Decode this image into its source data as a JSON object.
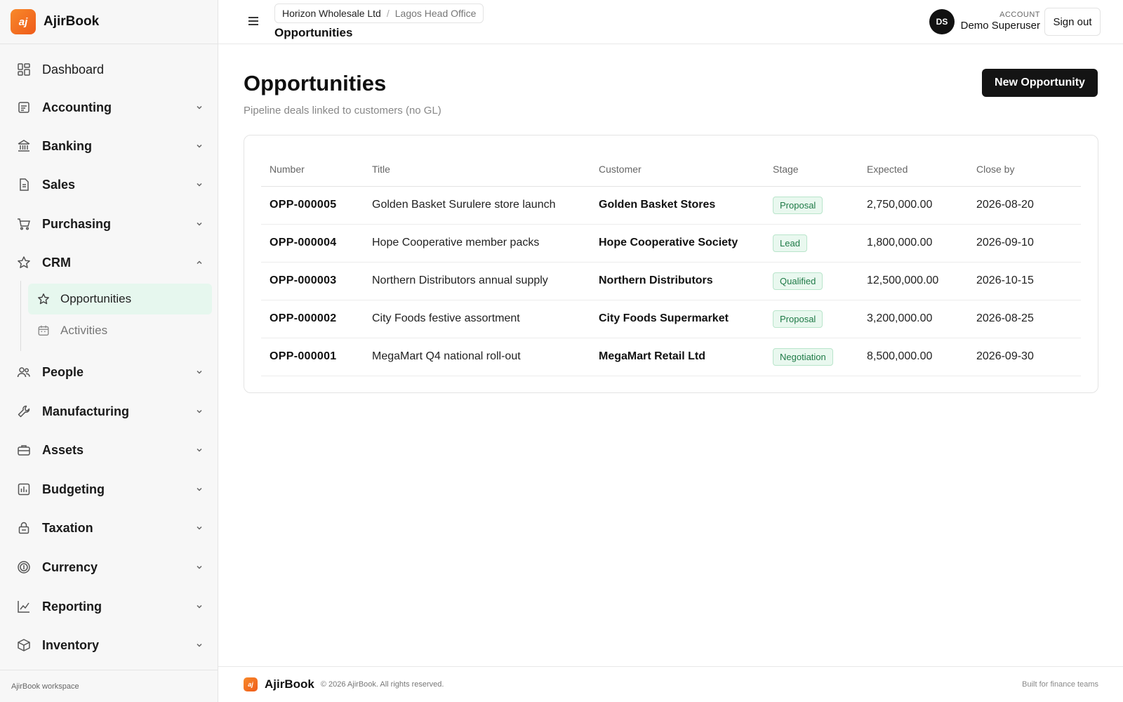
{
  "brand": {
    "name": "AjirBook",
    "logo_text": "aj",
    "accent": "#f26b21"
  },
  "sidebar": {
    "items": [
      {
        "label": "Dashboard",
        "icon": "dashboard-icon"
      },
      {
        "label": "Accounting",
        "icon": "accounting-icon"
      },
      {
        "label": "Banking",
        "icon": "bank-icon"
      },
      {
        "label": "Sales",
        "icon": "sales-icon"
      },
      {
        "label": "Purchasing",
        "icon": "cart-icon"
      },
      {
        "label": "CRM",
        "icon": "star-icon",
        "expanded": true
      },
      {
        "label": "People",
        "icon": "people-icon"
      },
      {
        "label": "Manufacturing",
        "icon": "wrench-icon"
      },
      {
        "label": "Assets",
        "icon": "briefcase-icon"
      },
      {
        "label": "Budgeting",
        "icon": "budget-icon"
      },
      {
        "label": "Taxation",
        "icon": "lock-icon"
      },
      {
        "label": "Currency",
        "icon": "currency-icon"
      },
      {
        "label": "Reporting",
        "icon": "chart-icon"
      },
      {
        "label": "Inventory",
        "icon": "box-icon"
      }
    ],
    "crm_sub": [
      {
        "label": "Opportunities",
        "icon": "star-icon",
        "active": true
      },
      {
        "label": "Activities",
        "icon": "calendar-icon",
        "active": false
      }
    ],
    "footer": "AjirBook workspace"
  },
  "topbar": {
    "org": "Horizon Wholesale Ltd",
    "separator": "/",
    "branch": "Lagos Head Office",
    "title": "Opportunities",
    "avatar_initials": "DS",
    "account_label": "ACCOUNT",
    "account_name": "Demo Superuser",
    "signout": "Sign out"
  },
  "page": {
    "title": "Opportunities",
    "subtitle": "Pipeline deals linked to customers (no GL)",
    "new_button": "New Opportunity"
  },
  "table": {
    "columns": [
      "Number",
      "Title",
      "Customer",
      "Stage",
      "Expected",
      "Close by"
    ],
    "rows": [
      {
        "number": "OPP-000005",
        "title": "Golden Basket Surulere store launch",
        "customer": "Golden Basket Stores",
        "stage": "Proposal",
        "expected": "2,750,000.00",
        "close_by": "2026-08-20"
      },
      {
        "number": "OPP-000004",
        "title": "Hope Cooperative member packs",
        "customer": "Hope Cooperative Society",
        "stage": "Lead",
        "expected": "1,800,000.00",
        "close_by": "2026-09-10"
      },
      {
        "number": "OPP-000003",
        "title": "Northern Distributors annual supply",
        "customer": "Northern Distributors",
        "stage": "Qualified",
        "expected": "12,500,000.00",
        "close_by": "2026-10-15"
      },
      {
        "number": "OPP-000002",
        "title": "City Foods festive assortment",
        "customer": "City Foods Supermarket",
        "stage": "Proposal",
        "expected": "3,200,000.00",
        "close_by": "2026-08-25"
      },
      {
        "number": "OPP-000001",
        "title": "MegaMart Q4 national roll-out",
        "customer": "MegaMart Retail Ltd",
        "stage": "Negotiation",
        "expected": "8,500,000.00",
        "close_by": "2026-09-30"
      }
    ]
  },
  "footer": {
    "brand": "AjirBook",
    "copyright": "© 2026 AjirBook. All rights reserved.",
    "tagline": "Built for finance teams"
  },
  "colors": {
    "badge_bg": "#e9f8ef",
    "badge_text": "#1f7a47",
    "active_nav_bg": "#e6f7ee",
    "primary_button": "#141414"
  }
}
